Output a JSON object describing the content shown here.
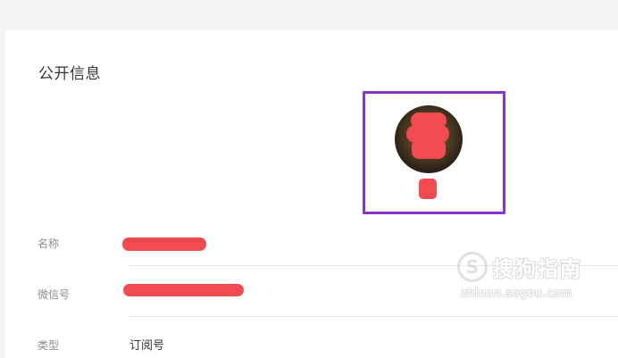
{
  "public_info": {
    "title": "公开信息",
    "rows": [
      {
        "label": "名称",
        "value": ""
      },
      {
        "label": "微信号",
        "value": ""
      },
      {
        "label": "类型",
        "value": "订阅号"
      }
    ]
  },
  "colors": {
    "highlight_border": "#8a34c4",
    "redaction": "#ef4b50"
  },
  "watermark": {
    "mark": "S",
    "brand": "搜狗指南",
    "url": "zhinan.sogou.com"
  }
}
